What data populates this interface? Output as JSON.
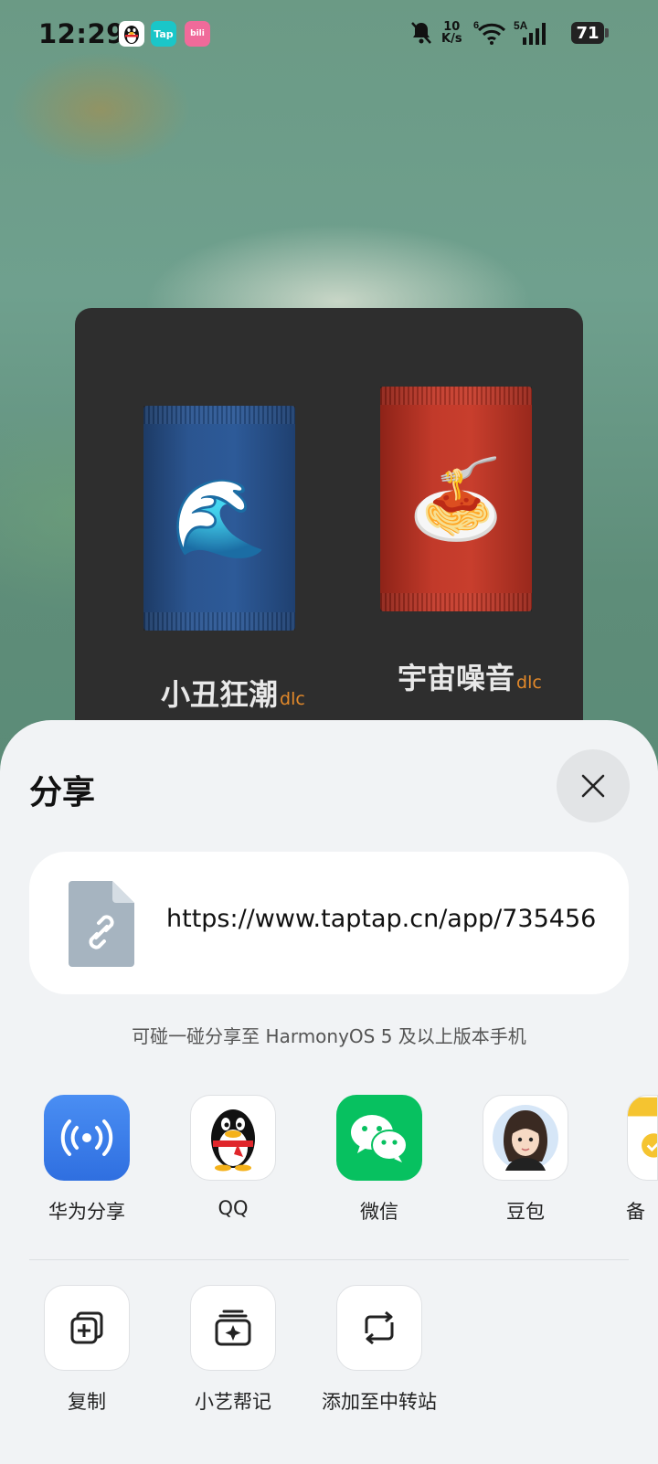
{
  "status_bar": {
    "time": "12:29",
    "apps": [
      "QQ",
      "TapTap",
      "bilibili"
    ],
    "net_speed_value": "10",
    "net_speed_unit": "K/s",
    "wifi_label": "6",
    "signal_label": "5A",
    "battery": "71"
  },
  "card": {
    "items": [
      {
        "title": "小丑狂潮",
        "badge": "dlc",
        "icon": "wave-icon",
        "color": "#2b5590"
      },
      {
        "title": "宇宙噪音",
        "badge": "dlc",
        "icon": "spaghetti-icon",
        "color": "#c23a2a"
      }
    ]
  },
  "share_sheet": {
    "title": "分享",
    "link": "https://www.taptap.cn/app/735456",
    "hint": "可碰一碰分享至 HarmonyOS 5 及以上版本手机",
    "apps": [
      {
        "label": "华为分享",
        "icon": "huawei-share-icon"
      },
      {
        "label": "QQ",
        "icon": "qq-penguin-icon"
      },
      {
        "label": "微信",
        "icon": "wechat-icon"
      },
      {
        "label": "豆包",
        "icon": "doubao-avatar-icon"
      },
      {
        "label": "备",
        "icon": "memo-icon"
      }
    ],
    "actions": [
      {
        "label": "复制",
        "icon": "copy-icon"
      },
      {
        "label": "小艺帮记",
        "icon": "xiaoyi-note-icon"
      },
      {
        "label": "添加至中转站",
        "icon": "transfer-station-icon"
      }
    ]
  },
  "colors": {
    "accent_blue": "#3a7be8",
    "wechat_green": "#07c160",
    "dlc_orange": "#e3892a",
    "sheet_bg": "#f1f3f5"
  }
}
